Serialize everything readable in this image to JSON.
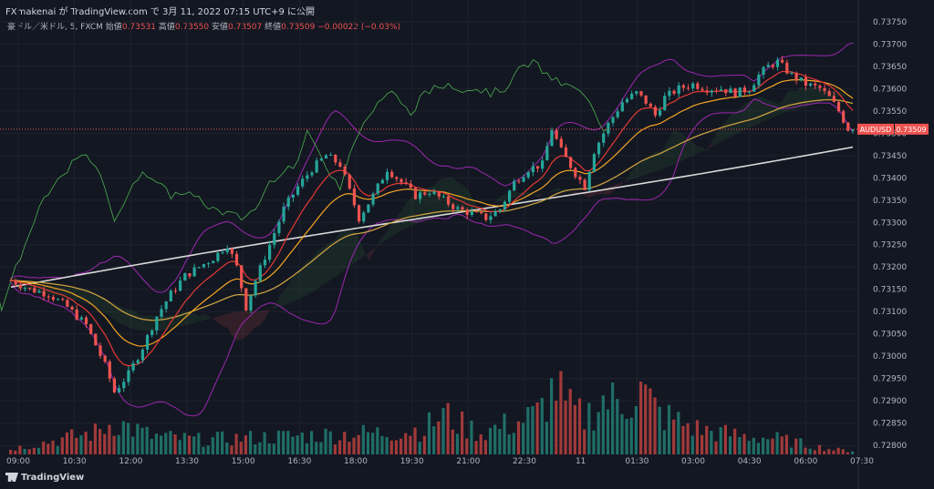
{
  "header": {
    "author": "FXmakenai",
    "published_text": "FXmakenai が TradingView.com で 3月 11, 2022 07:15 UTC+9 に公開"
  },
  "legend": {
    "symbol_text": "豪ドル／米ドル, 5, FXCM",
    "open_label": "始値",
    "open": "0.73531",
    "high_label": "高値",
    "high": "0.73550",
    "low_label": "安値",
    "low": "0.73507",
    "close_label": "終値",
    "close": "0.73509",
    "change": "−0.00022 (−0.03%)"
  },
  "price_tag": {
    "symbol": "AUDUSD",
    "price": "0.73509"
  },
  "brand": "TradingView",
  "colors": {
    "background": "#131722",
    "grid": "#1e222d",
    "up": "#26a69a",
    "down": "#ef5350",
    "ma_red": "#e53935",
    "ma_orange": "#f5a623",
    "ma_gold": "#c8a040",
    "ma_white": "#d8d8d8",
    "bollinger": "#9c27b0",
    "chikou": "#4caf50",
    "volume_up": "#1f6e67",
    "volume_down": "#a13a3a"
  },
  "chart_data": {
    "type": "candlestick",
    "symbol": "AUDUSD",
    "timeframe": "5",
    "x_tick_labels": [
      "09:00",
      "10:30",
      "12:00",
      "13:30",
      "15:00",
      "16:30",
      "18:00",
      "19:30",
      "21:00",
      "22:30",
      "11",
      "01:30",
      "03:00",
      "04:30",
      "06:00",
      "07:30"
    ],
    "y_tick_labels": [
      "0.73750",
      "0.73700",
      "0.73650",
      "0.73600",
      "0.73550",
      "0.73500",
      "0.73450",
      "0.73400",
      "0.73350",
      "0.73300",
      "0.73250",
      "0.73200",
      "0.73150",
      "0.73100",
      "0.73050",
      "0.73000",
      "0.72950",
      "0.72900",
      "0.72850",
      "0.72800"
    ],
    "ylim": [
      0.7278,
      0.7377
    ],
    "last_price": 0.73509,
    "price_path": [
      [
        0,
        0.7317
      ],
      [
        4,
        0.7315
      ],
      [
        8,
        0.7314
      ],
      [
        12,
        0.7311
      ],
      [
        16,
        0.7307
      ],
      [
        20,
        0.7298
      ],
      [
        22,
        0.7292
      ],
      [
        25,
        0.7296
      ],
      [
        28,
        0.7302
      ],
      [
        31,
        0.7309
      ],
      [
        34,
        0.7314
      ],
      [
        37,
        0.7318
      ],
      [
        40,
        0.732
      ],
      [
        43,
        0.7322
      ],
      [
        46,
        0.7325
      ],
      [
        48,
        0.732
      ],
      [
        50,
        0.7311
      ],
      [
        52,
        0.7317
      ],
      [
        55,
        0.7325
      ],
      [
        58,
        0.7333
      ],
      [
        61,
        0.7338
      ],
      [
        64,
        0.7342
      ],
      [
        67,
        0.7345
      ],
      [
        70,
        0.7343
      ],
      [
        72,
        0.7337
      ],
      [
        74,
        0.7331
      ],
      [
        77,
        0.7336
      ],
      [
        80,
        0.7342
      ],
      [
        83,
        0.7339
      ],
      [
        86,
        0.7336
      ],
      [
        89,
        0.7337
      ],
      [
        92,
        0.7335
      ],
      [
        95,
        0.7333
      ],
      [
        98,
        0.7332
      ],
      [
        101,
        0.7331
      ],
      [
        104,
        0.7333
      ],
      [
        107,
        0.7339
      ],
      [
        110,
        0.7342
      ],
      [
        113,
        0.7343
      ],
      [
        115,
        0.7351
      ],
      [
        117,
        0.7346
      ],
      [
        120,
        0.7341
      ],
      [
        122,
        0.7338
      ],
      [
        124,
        0.7346
      ],
      [
        127,
        0.7352
      ],
      [
        130,
        0.7357
      ],
      [
        133,
        0.7359
      ],
      [
        135,
        0.7357
      ],
      [
        137,
        0.7354
      ],
      [
        139,
        0.7358
      ],
      [
        142,
        0.736
      ],
      [
        145,
        0.7361
      ],
      [
        148,
        0.736
      ],
      [
        151,
        0.736
      ],
      [
        154,
        0.7359
      ],
      [
        157,
        0.736
      ],
      [
        159,
        0.7363
      ],
      [
        161,
        0.7365
      ],
      [
        163,
        0.7366
      ],
      [
        166,
        0.7363
      ],
      [
        169,
        0.7361
      ],
      [
        172,
        0.736
      ],
      [
        174,
        0.7358
      ],
      [
        176,
        0.7355
      ],
      [
        178,
        0.7351
      ]
    ],
    "volume_profile": [
      [
        0,
        3
      ],
      [
        10,
        8
      ],
      [
        18,
        12
      ],
      [
        22,
        18
      ],
      [
        26,
        14
      ],
      [
        30,
        10
      ],
      [
        40,
        8
      ],
      [
        50,
        9
      ],
      [
        60,
        10
      ],
      [
        70,
        11
      ],
      [
        80,
        12
      ],
      [
        88,
        14
      ],
      [
        92,
        22
      ],
      [
        96,
        16
      ],
      [
        100,
        12
      ],
      [
        108,
        18
      ],
      [
        112,
        22
      ],
      [
        116,
        38
      ],
      [
        118,
        26
      ],
      [
        122,
        20
      ],
      [
        126,
        30
      ],
      [
        130,
        28
      ],
      [
        134,
        35
      ],
      [
        138,
        22
      ],
      [
        142,
        18
      ],
      [
        146,
        14
      ],
      [
        150,
        12
      ],
      [
        156,
        10
      ],
      [
        162,
        9
      ],
      [
        168,
        6
      ],
      [
        174,
        3
      ],
      [
        178,
        2
      ]
    ]
  }
}
